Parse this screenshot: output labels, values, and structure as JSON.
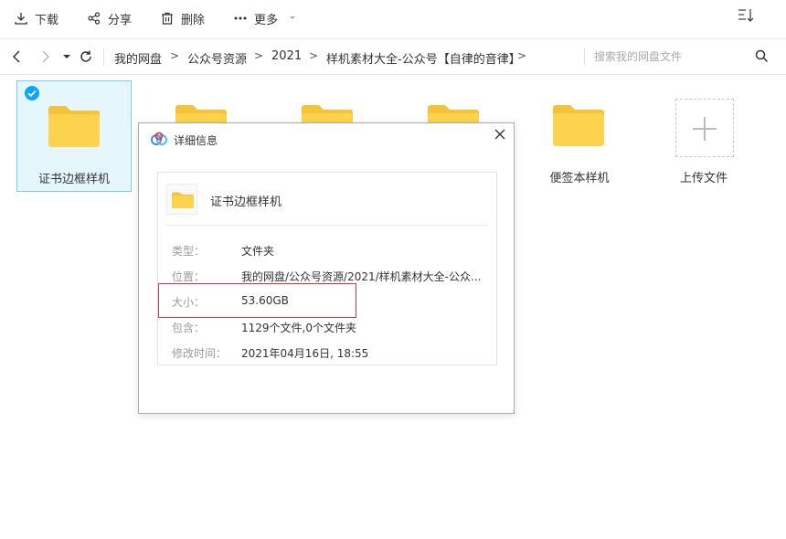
{
  "toolbar": {
    "download_label": "下载",
    "share_label": "分享",
    "delete_label": "删除",
    "more_label": "更多"
  },
  "breadcrumb": {
    "items": [
      "我的网盘",
      "公众号资源",
      "2021",
      "样机素材大全-公众号【自律的音律】"
    ],
    "separator": ">"
  },
  "search": {
    "placeholder": "搜索我的网盘文件"
  },
  "files": [
    {
      "name": "证书边框样机",
      "selected": true
    },
    {
      "name": "",
      "selected": false
    },
    {
      "name": "",
      "selected": false
    },
    {
      "name": "",
      "selected": false
    },
    {
      "name": "便签本样机",
      "selected": false
    }
  ],
  "upload": {
    "label": "上传文件"
  },
  "dialog": {
    "title": "详细信息",
    "item_name": "证书边框样机",
    "properties": [
      {
        "label": "类型：",
        "value": "文件夹"
      },
      {
        "label": "位置：",
        "value": "我的网盘/公众号资源/2021/样机素材大全-公众..."
      },
      {
        "label": "大小：",
        "value": "53.60GB"
      },
      {
        "label": "包含：",
        "value": "1129个文件,0个文件夹"
      },
      {
        "label": "修改时间：",
        "value": "2021年04月16日, 18:55"
      }
    ]
  },
  "colors": {
    "accent": "#06a7ff",
    "folder": "#fcd34d",
    "folder_tab": "#f6c338",
    "selected_bg": "#e6f6fd",
    "highlight": "#d9363e"
  }
}
